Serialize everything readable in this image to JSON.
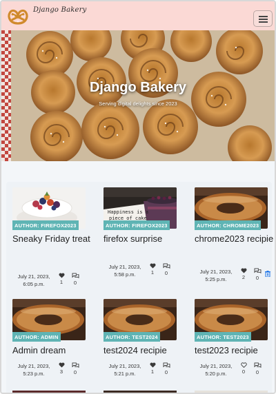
{
  "brand": {
    "name": "Django Bakery"
  },
  "nav": {
    "toggler_icon": "hamburger-icon"
  },
  "hero": {
    "title": "Django Bakery",
    "subtitle": "Serving digital delights since 2023"
  },
  "colors": {
    "navbar": "#fbd9d5",
    "author_badge": "#5fb4b4",
    "delete": "#1a73e8"
  },
  "posts": [
    {
      "author": "AUTHOR: FIREFOX2023",
      "title": "Sneaky Friday treat",
      "date": "July 21, 2023, 6:05 p.m.",
      "likes": "1",
      "comments": "0",
      "image": "pavlova",
      "deletable": false
    },
    {
      "author": "AUTHOR: FIREFOX2023",
      "title": "firefox surprise",
      "date": "July 21, 2023, 5:58 p.m.",
      "likes": "1",
      "comments": "0",
      "image": "cake-happiness",
      "deletable": false
    },
    {
      "author": "AUTHOR: CHROME2023",
      "title": "chrome2023 recipie",
      "date": "July 21, 2023, 5:25 p.m.",
      "likes": "2",
      "comments": "0",
      "image": "donut",
      "deletable": true
    },
    {
      "author": "AUTHOR: ADMIN",
      "title": "Admin dream",
      "date": "July 21, 2023, 5:23 p.m.",
      "likes": "3",
      "comments": "0",
      "image": "donut",
      "deletable": false
    },
    {
      "author": "AUTHOR: TEST2024",
      "title": "test2024 recipie",
      "date": "July 21, 2023, 5:21 p.m.",
      "likes": "1",
      "comments": "0",
      "image": "donut",
      "deletable": false
    },
    {
      "author": "AUTHOR: TEST2023",
      "title": "test2023 recipie",
      "date": "July 21, 2023, 5:20 p.m.",
      "likes": "0",
      "comments": "0",
      "image": "donut",
      "deletable": false
    }
  ]
}
